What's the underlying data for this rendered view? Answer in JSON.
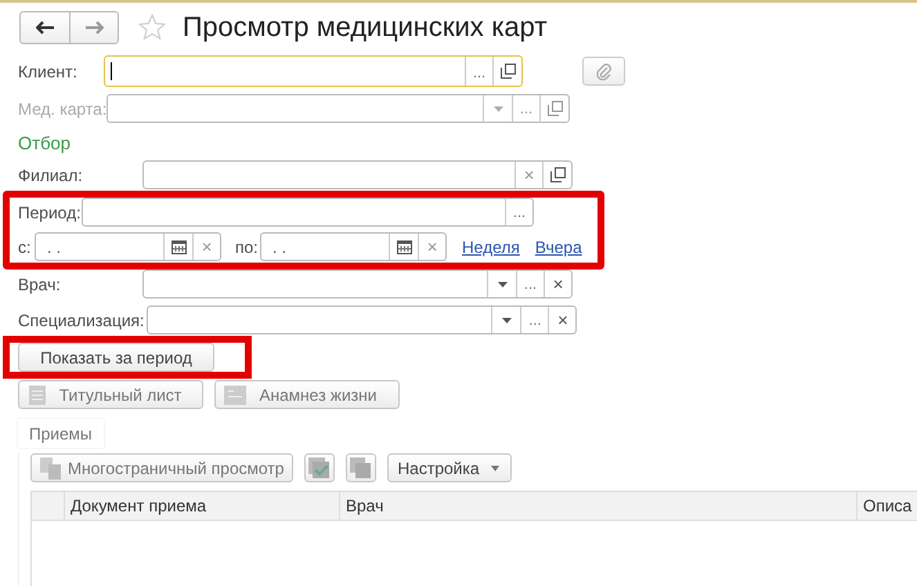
{
  "window": {
    "title": "Просмотр медицинских карт",
    "favorite": false
  },
  "client": {
    "label": "Клиент:",
    "focused": true,
    "buttons": [
      {
        "kind": "choice",
        "text": "..."
      },
      {
        "kind": "open"
      }
    ]
  },
  "med_card": {
    "label": "Мед. карта:",
    "disabled": true,
    "buttons": [
      {
        "kind": "dropdown"
      },
      {
        "kind": "choice",
        "text": "..."
      },
      {
        "kind": "open"
      }
    ]
  },
  "filter": {
    "heading": "Отбор",
    "branch": {
      "label": "Филиал:",
      "buttons": [
        {
          "kind": "clear",
          "text": "×"
        },
        {
          "kind": "open"
        }
      ]
    },
    "period": {
      "highlighted": true,
      "label": "Период:",
      "buttons": [
        {
          "kind": "choice",
          "text": "..."
        }
      ],
      "from": {
        "label": "с:",
        "value": ".  .",
        "buttons": [
          {
            "kind": "calendar"
          },
          {
            "kind": "clear",
            "text": "×"
          }
        ]
      },
      "to": {
        "label": "по:",
        "value": ".  .",
        "buttons": [
          {
            "kind": "calendar"
          },
          {
            "kind": "clear",
            "text": "×"
          }
        ]
      },
      "links": [
        "Неделя",
        "Вчера"
      ]
    },
    "doctor": {
      "label": "Врач:",
      "buttons": [
        {
          "kind": "dropdown"
        },
        {
          "kind": "choice",
          "text": "..."
        },
        {
          "kind": "clear",
          "text": "×"
        }
      ]
    },
    "specialization": {
      "label": "Специализация:",
      "buttons": [
        {
          "kind": "dropdown"
        },
        {
          "kind": "choice",
          "text": "..."
        },
        {
          "kind": "clear",
          "text": "×"
        }
      ]
    }
  },
  "show_button": {
    "label": "Показать за период",
    "highlighted": true
  },
  "form_buttons": [
    {
      "label": "Титульный лист",
      "kind": "sheet"
    },
    {
      "label": "Анамнез жизни",
      "kind": "card"
    }
  ],
  "tabs": [
    {
      "label": "Приемы",
      "selected": true
    }
  ],
  "toolbar": {
    "multipage": "Многостраничный просмотр",
    "settings": "Настройка"
  },
  "table": {
    "columns": [
      "Документ приема",
      "Врач",
      "Описа"
    ]
  }
}
